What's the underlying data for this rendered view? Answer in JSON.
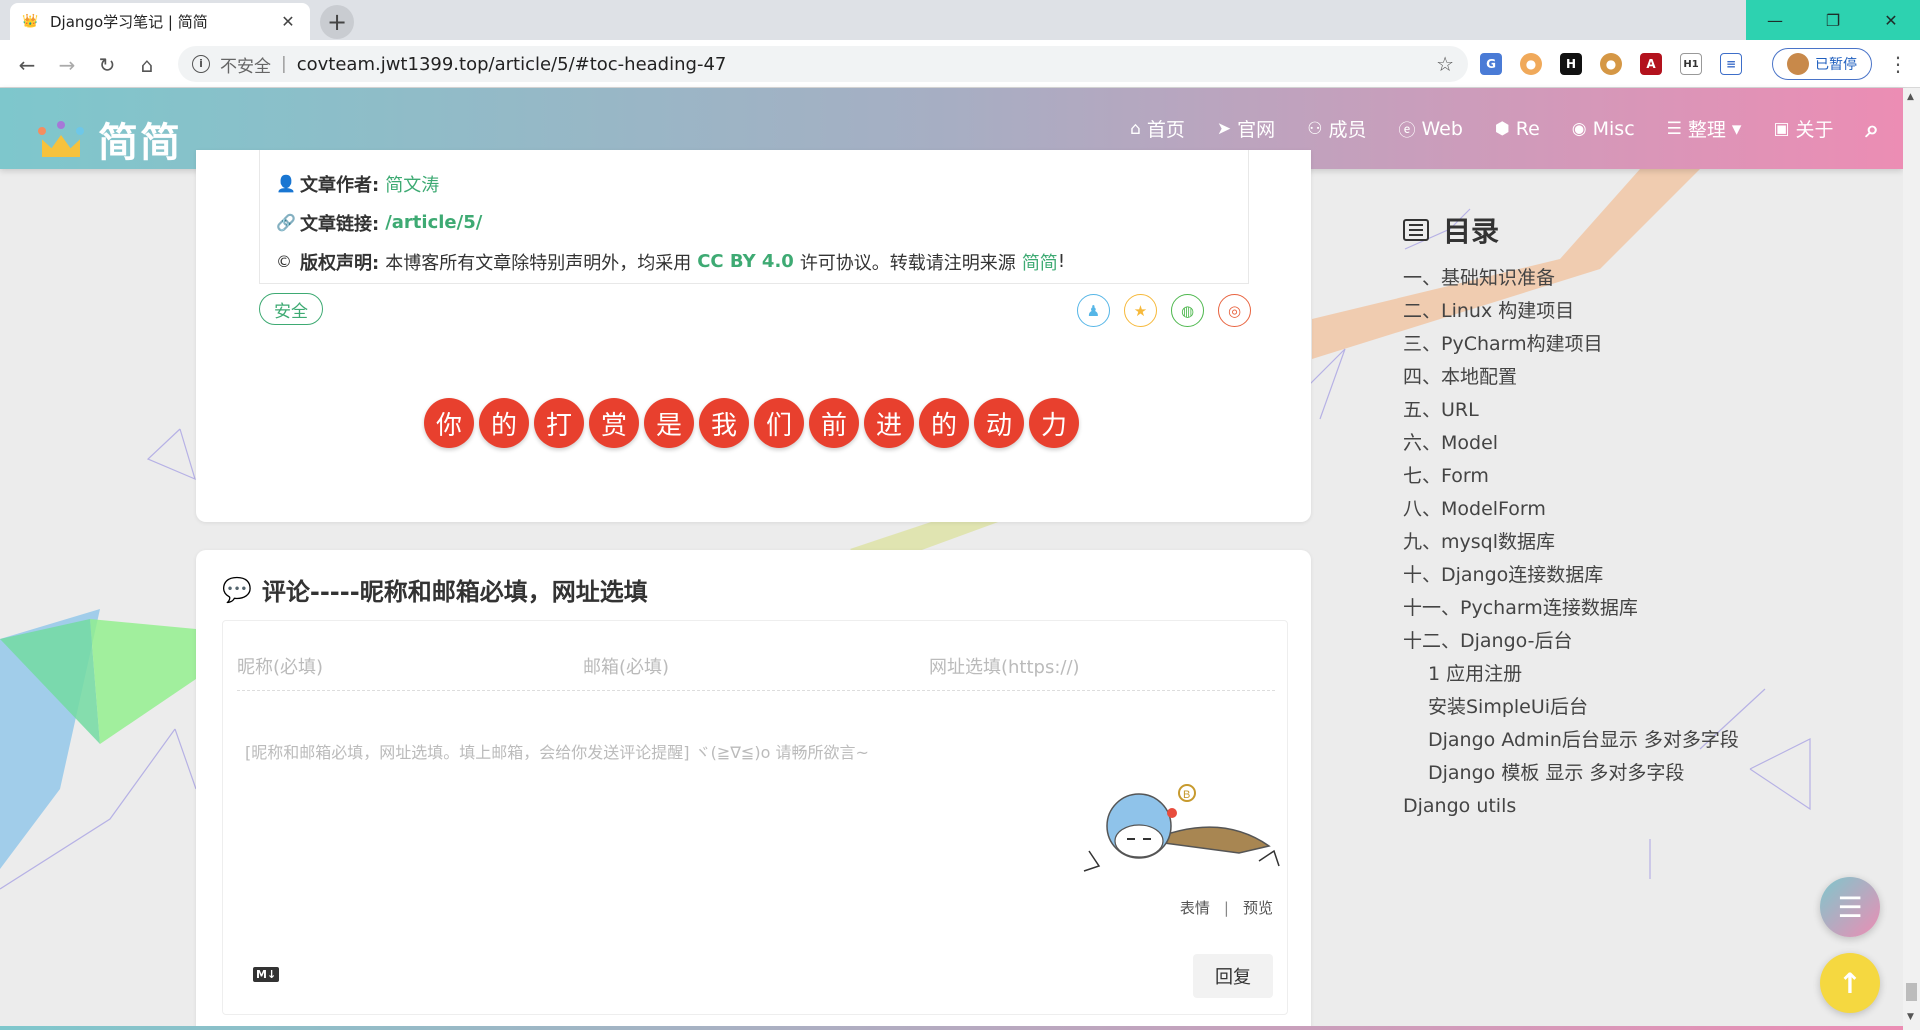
{
  "browser": {
    "tab_title": "Django学习笔记 | 简简",
    "tab_close": "✕",
    "new_tab": "+",
    "insecure_label": "不安全",
    "separator": "|",
    "url": "covteam.jwt1399.top/article/5/#toc-heading-47",
    "paused_label": "已暂停",
    "window": {
      "minimize": "—",
      "restore": "❐",
      "close": "✕"
    }
  },
  "site": {
    "logo_text": "简简",
    "nav": [
      {
        "label": "首页",
        "icon": "home-icon",
        "glyph": "⌂"
      },
      {
        "label": "官网",
        "icon": "paper-plane-icon",
        "glyph": "➤"
      },
      {
        "label": "成员",
        "icon": "users-icon",
        "glyph": "⚇"
      },
      {
        "label": "Web",
        "icon": "edge-icon",
        "glyph": "ⓔ"
      },
      {
        "label": "Re",
        "icon": "cube-icon",
        "glyph": "⬢"
      },
      {
        "label": "Misc",
        "icon": "gamepad-icon",
        "glyph": "◉"
      },
      {
        "label": "整理",
        "icon": "list-icon",
        "glyph": "☰",
        "caret": "▾"
      },
      {
        "label": "关于",
        "icon": "id-card-icon",
        "glyph": "▣"
      }
    ],
    "search_icon": "⌕"
  },
  "article": {
    "author_label": "文章作者:",
    "author": "简文涛",
    "link_label": "文章链接:",
    "link": "/article/5/",
    "license_label": "版权声明:",
    "license_pre": "本博客所有文章除特别声明外，均采用",
    "license_name": "CC BY 4.0",
    "license_mid": "许可协议。转载请注明来源",
    "license_source": "简简",
    "license_end": "!",
    "tag": "安全",
    "reward_chars": [
      "你",
      "的",
      "打",
      "赏",
      "是",
      "我",
      "们",
      "前",
      "进",
      "的",
      "动",
      "力"
    ]
  },
  "comments": {
    "title": "评论-----昵称和邮箱必填，网址选填",
    "nickname_placeholder": "昵称(必填)",
    "email_placeholder": "邮箱(必填)",
    "website_placeholder": "网址选填(https://)",
    "textarea_placeholder": "[昵称和邮箱必填，网址选填。填上邮箱，会给你发送评论提醒] ヾ(≧∇≦)o 请畅所欲言~",
    "emoji_label": "表情",
    "divider": "|",
    "preview_label": "预览",
    "markdown_badge": "M↓",
    "reply_label": "回复"
  },
  "toc": {
    "title": "目录",
    "items": [
      {
        "label": "一、基础知识准备",
        "level": 1
      },
      {
        "label": "二、Linux 构建项目",
        "level": 1
      },
      {
        "label": "三、PyCharm构建项目",
        "level": 1
      },
      {
        "label": "四、本地配置",
        "level": 1
      },
      {
        "label": "五、URL",
        "level": 1
      },
      {
        "label": "六、Model",
        "level": 1
      },
      {
        "label": "七、Form",
        "level": 1
      },
      {
        "label": "八、ModelForm",
        "level": 1
      },
      {
        "label": "九、mysql数据库",
        "level": 1
      },
      {
        "label": "十、Django连接数据库",
        "level": 1
      },
      {
        "label": "十一、Pycharm连接数据库",
        "level": 1
      },
      {
        "label": "十二、Django-后台",
        "level": 1
      },
      {
        "label": "1 应用注册",
        "level": 2
      },
      {
        "label": "安装SimpleUi后台",
        "level": 2
      },
      {
        "label": "Django Admin后台显示 多对多字段",
        "level": 2
      },
      {
        "label": "Django 模板 显示 多对多字段",
        "level": 2
      },
      {
        "label": "Django utils",
        "level": 1
      }
    ]
  },
  "colors": {
    "accent_green": "#3eaa73",
    "reward_red": "#e8402e",
    "header_start": "#7ec7cc",
    "header_end": "#ec8db4",
    "fab_top": "#f5d840"
  }
}
